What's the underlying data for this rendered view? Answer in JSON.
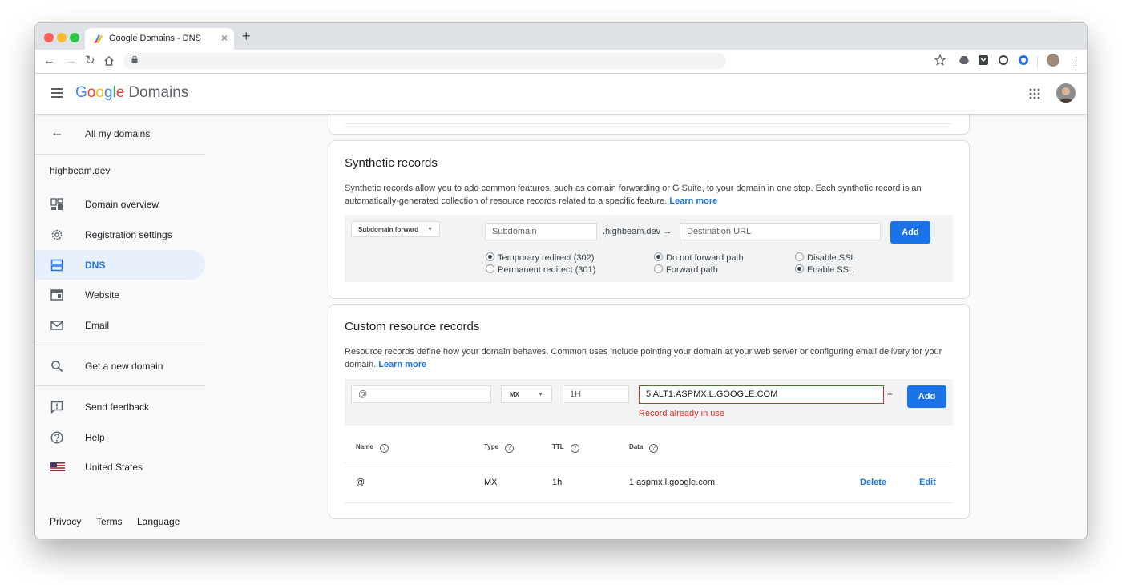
{
  "browser": {
    "tab_title": "Google Domains - DNS",
    "tab_close": "×",
    "new_tab": "+",
    "colors": {
      "close": "#ff5f57",
      "minimize": "#febc2e",
      "zoom": "#28c840"
    }
  },
  "header": {
    "logo_letters": [
      "G",
      "o",
      "o",
      "g",
      "l",
      "e"
    ],
    "product": "Domains"
  },
  "sidebar": {
    "back_label": "All my domains",
    "domain": "highbeam.dev",
    "items": [
      {
        "label": "Domain overview",
        "icon": "dashboard-icon"
      },
      {
        "label": "Registration settings",
        "icon": "settings-icon"
      },
      {
        "label": "DNS",
        "icon": "dns-icon",
        "active": true
      },
      {
        "label": "Website",
        "icon": "website-icon"
      },
      {
        "label": "Email",
        "icon": "email-icon"
      }
    ],
    "get_domain": "Get a new domain",
    "send_feedback": "Send feedback",
    "help": "Help",
    "country": "United States",
    "footer": [
      "Privacy",
      "Terms",
      "Language"
    ]
  },
  "synthetic": {
    "title": "Synthetic records",
    "description": "Synthetic records allow you to add common features, such as domain forwarding or G Suite, to your domain in one step. Each synthetic record is an automatically-generated collection of resource records related to a specific feature.",
    "learn_more": "Learn more",
    "type_select": "Subdomain forward",
    "subdomain_placeholder": "Subdomain",
    "domain_suffix": ".highbeam.dev →",
    "destination_placeholder": "Destination URL",
    "add_label": "Add",
    "redirect_options": [
      "Temporary redirect (302)",
      "Permanent redirect (301)"
    ],
    "path_options": [
      "Do not forward path",
      "Forward path"
    ],
    "ssl_options": [
      "Disable SSL",
      "Enable SSL"
    ]
  },
  "custom": {
    "title": "Custom resource records",
    "description": "Resource records define how your domain behaves. Common uses include pointing your domain at your web server or configuring email delivery for your domain.",
    "learn_more": "Learn more",
    "name_value": "@",
    "type_value": "MX",
    "ttl_value": "1H",
    "data_value": "5 ALT1.ASPMX.L.GOOGLE.COM",
    "plus": "+",
    "add_label": "Add",
    "error": "Record already in use",
    "columns": [
      "Name",
      "Type",
      "TTL",
      "Data"
    ],
    "rows": [
      {
        "name": "@",
        "type": "MX",
        "ttl": "1h",
        "data": "1 aspmx.l.google.com."
      }
    ],
    "delete_label": "Delete",
    "edit_label": "Edit"
  }
}
